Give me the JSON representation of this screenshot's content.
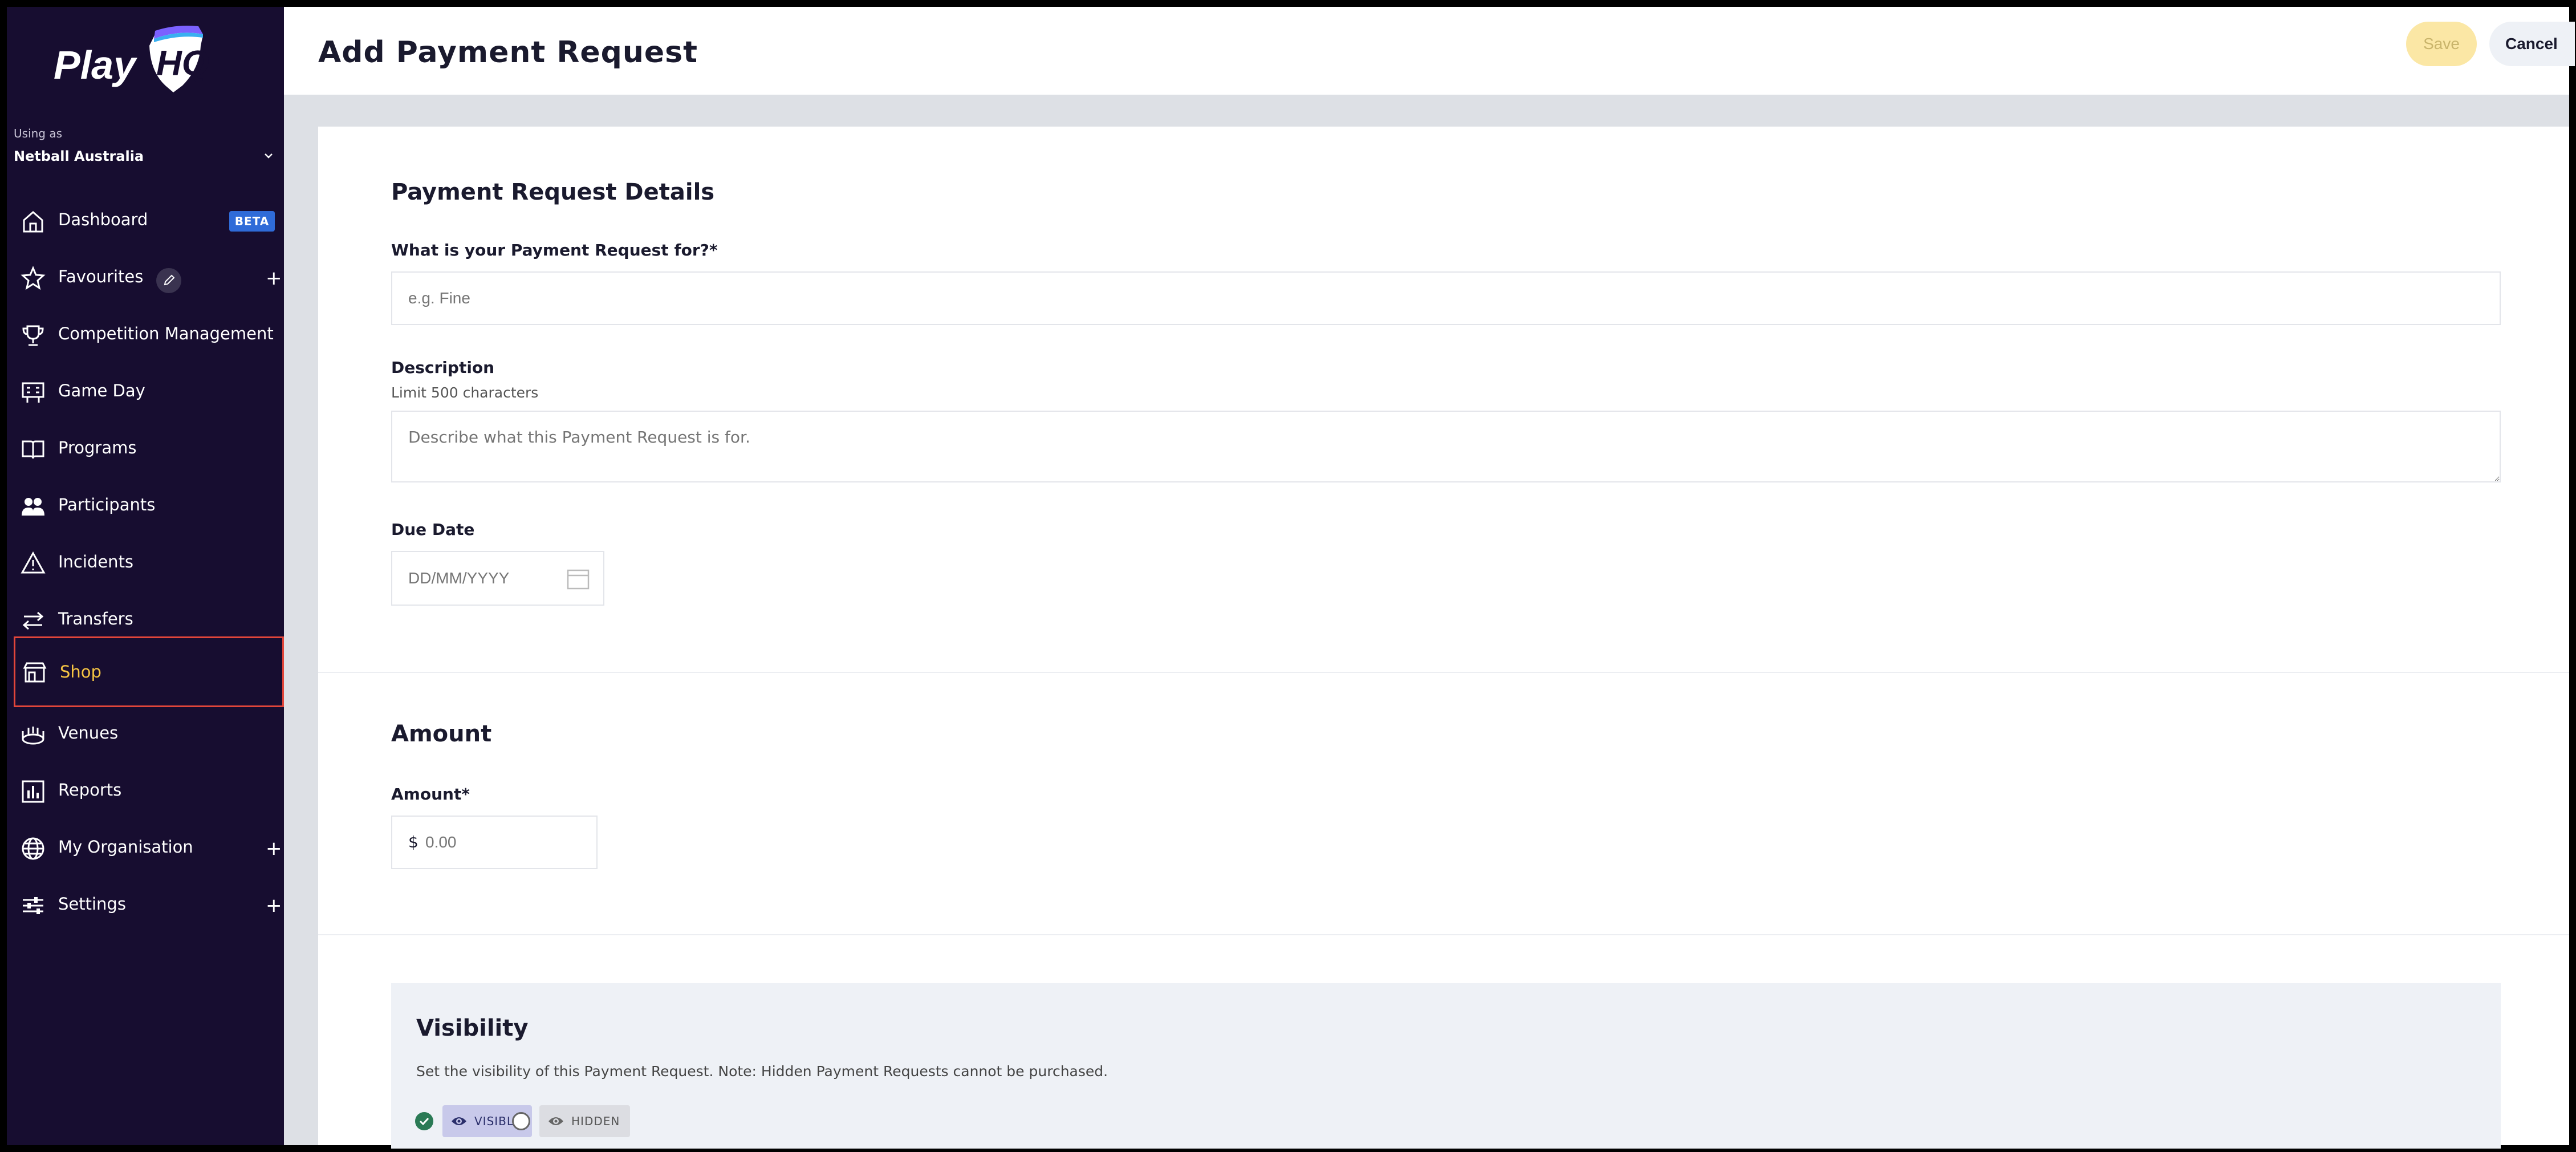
{
  "sidebar": {
    "brand": "PlayHQ",
    "using_as_label": "Using as",
    "organisation": "Netball Australia",
    "items": [
      {
        "label": "Dashboard",
        "badge": "BETA"
      },
      {
        "label": "Favourites",
        "plus": "+"
      },
      {
        "label": "Competition Management"
      },
      {
        "label": "Game Day"
      },
      {
        "label": "Programs"
      },
      {
        "label": "Participants"
      },
      {
        "label": "Incidents"
      },
      {
        "label": "Transfers"
      },
      {
        "label": "Shop",
        "active": true
      },
      {
        "label": "Venues"
      },
      {
        "label": "Reports"
      },
      {
        "label": "My Organisation",
        "plus": "+"
      },
      {
        "label": "Settings",
        "plus": "+"
      }
    ]
  },
  "header": {
    "title": "Add Payment Request",
    "save_label": "Save",
    "cancel_label": "Cancel"
  },
  "details": {
    "title": "Payment Request Details",
    "for_label": "What is your Payment Request for?*",
    "for_placeholder": "e.g. Fine",
    "description_label": "Description",
    "description_hint": "Limit 500 characters",
    "description_placeholder": "Describe what this Payment Request is for.",
    "due_date_label": "Due Date",
    "due_date_placeholder": "DD/MM/YYYY"
  },
  "amount": {
    "title": "Amount",
    "label": "Amount*",
    "currency": "$",
    "placeholder": "0.00"
  },
  "visibility": {
    "title": "Visibility",
    "description": "Set the visibility of this Payment Request. Note: Hidden Payment Requests cannot be purchased.",
    "visible_label": "VISIBLE",
    "hidden_label": "HIDDEN",
    "selected": "VISIBLE"
  },
  "colors": {
    "sidebar_bg": "#170d30",
    "active_text": "#f5c443",
    "active_border": "#e2463a",
    "beta_badge": "#2f6bd8",
    "save_bg": "#fbe7a5",
    "check_green": "#2a7a55"
  }
}
